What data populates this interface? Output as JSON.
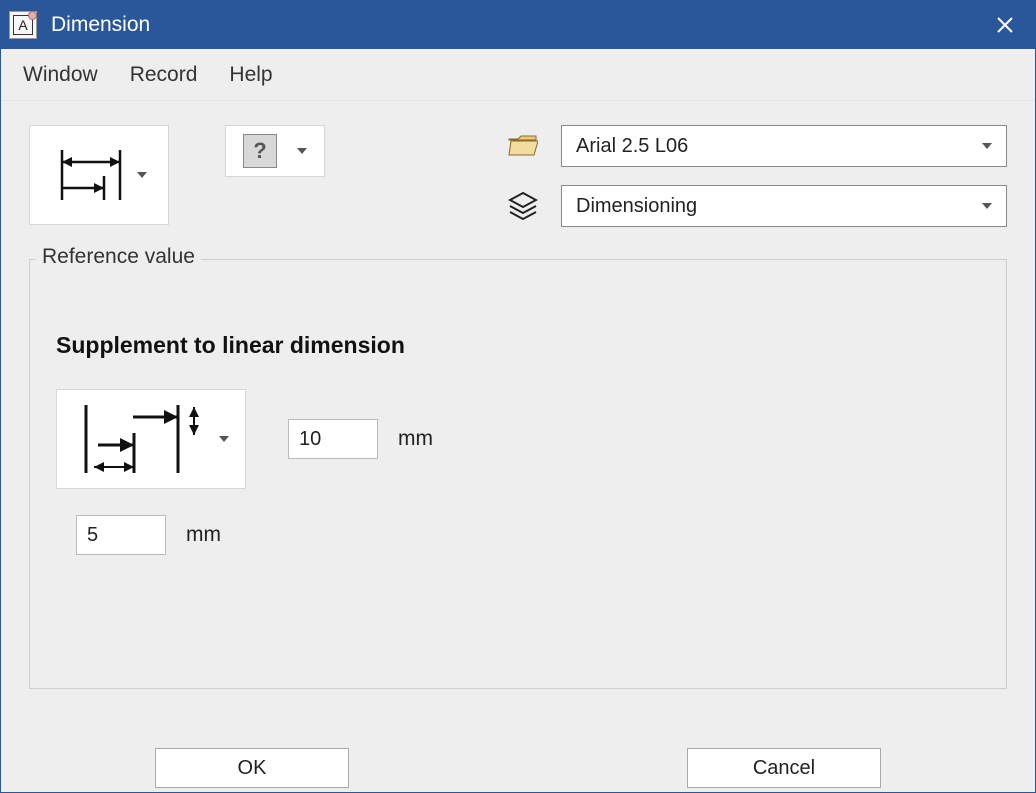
{
  "window": {
    "title": "Dimension"
  },
  "menu": {
    "window": "Window",
    "record": "Record",
    "help": "Help"
  },
  "toolbar": {
    "font_combo": "Arial 2.5 L06",
    "layer_combo": "Dimensioning"
  },
  "fieldset": {
    "legend": "Reference value",
    "heading": "Supplement to linear dimension",
    "value1": "10",
    "unit1": "mm",
    "value2": "5",
    "unit2": "mm"
  },
  "buttons": {
    "ok": "OK",
    "cancel": "Cancel"
  }
}
